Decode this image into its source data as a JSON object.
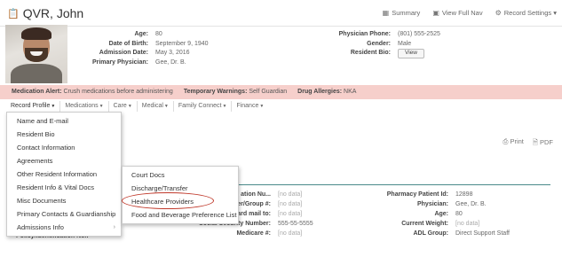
{
  "header": {
    "title": "QVR, John",
    "actions": [
      "Summary",
      "View Full Nav",
      "Record Settings"
    ]
  },
  "patient": {
    "left": [
      {
        "label": "Age:",
        "value": "80"
      },
      {
        "label": "Date of Birth:",
        "value": "September 9, 1940"
      },
      {
        "label": "Admission Date:",
        "value": "May 3, 2016"
      },
      {
        "label": "Primary Physician:",
        "value": "Gee, Dr. B."
      }
    ],
    "right": [
      {
        "label": "Physician Phone:",
        "value": "(801) 555-2525"
      },
      {
        "label": "Gender:",
        "value": "Male"
      },
      {
        "label": "Resident Bio:",
        "value": ""
      }
    ],
    "view_button": "View"
  },
  "alert": {
    "med_label": "Medication Alert:",
    "med_value": "Crush medications before administering",
    "warn_label": "Temporary Warnings:",
    "warn_value": "Self Guardian",
    "allergy_label": "Drug Allergies:",
    "allergy_value": "NKA"
  },
  "nav": [
    "Record Profile",
    "Medications",
    "Care",
    "Medical",
    "Family Connect",
    "Finance"
  ],
  "print_actions": [
    "Print",
    "PDF"
  ],
  "menu_record_profile": [
    "Name and E-mail",
    "Resident Bio",
    "Contact Information",
    "Agreements",
    "Other Resident Information",
    "Resident Info & Vital Docs",
    "Misc Documents",
    "Primary Contacts & Guardianship",
    "Admissions Info"
  ],
  "submenu": [
    "Court Docs",
    "Discharge/Transfer",
    "Healthcare Providers",
    "Food and Beverage Preference List"
  ],
  "details_left": [
    {
      "label": "ation Nu...",
      "value": "[no data]"
    },
    {
      "label": "er/Group #:",
      "value": "[no data]"
    },
    {
      "label": "ard mail to:",
      "value": "[no data]"
    },
    {
      "label": "Social Security Number:",
      "value": "555-55-5555"
    },
    {
      "label": "Medicare #:",
      "value": "[no data]"
    }
  ],
  "details_right": [
    {
      "label": "Pharmacy Patient Id:",
      "value": "12898"
    },
    {
      "label": "Physician:",
      "value": "Gee, Dr. B."
    },
    {
      "label": "Age:",
      "value": "80"
    },
    {
      "label": "Current Weight:",
      "value": "[no data]"
    },
    {
      "label": "ADL Group:",
      "value": "Direct Support Staff"
    }
  ],
  "bottom_partial_label": "Policy/Identification No.:",
  "colors": {
    "alert_bg": "#f6cfcb",
    "accent_line": "#4a8a8a",
    "highlight_ring": "#c0392b"
  }
}
